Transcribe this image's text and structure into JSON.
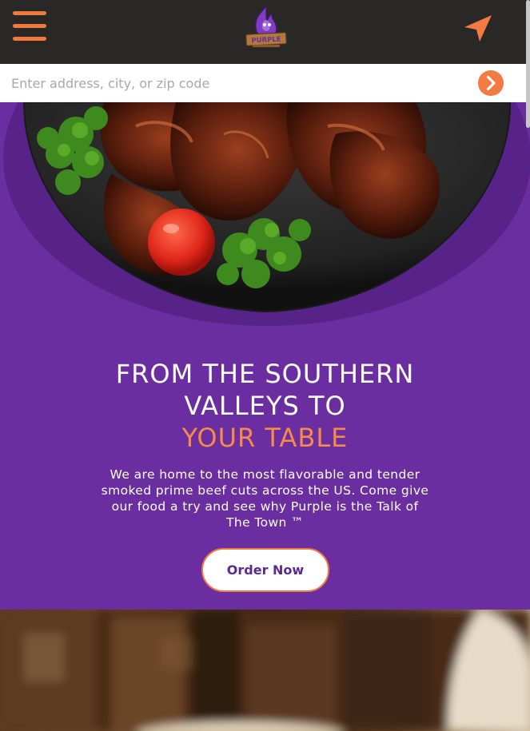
{
  "header": {
    "menu_icon": "hamburger-menu-icon",
    "logo_text": "PURPLE",
    "locate_icon": "navigation-arrow-icon"
  },
  "search": {
    "placeholder": "Enter address, city, or zip code",
    "value": "",
    "submit_icon": "chevron-right-icon"
  },
  "hero": {
    "headline_line1": "FROM THE SOUTHERN",
    "headline_line2": "VALLEYS TO",
    "headline_accent": "YOUR TABLE",
    "description": "We are home to the most flavorable and tender smoked prime beef cuts across the US. Come give our food a try and see why Purple is the Talk of The Town ™",
    "cta_label": "Order Now"
  },
  "colors": {
    "topbar": "#2a2827",
    "accent_orange": "#f47a44",
    "hero_purple": "#6a2ea0",
    "cta_text": "#5a2a91"
  }
}
